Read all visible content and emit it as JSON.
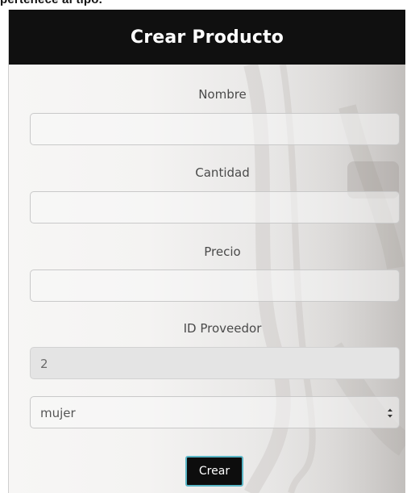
{
  "top_strip_text": "pertenece al tipo.",
  "form": {
    "title": "Crear Producto",
    "fields": [
      {
        "label": "Nombre",
        "value": ""
      },
      {
        "label": "Cantidad",
        "value": ""
      },
      {
        "label": "Precio",
        "value": ""
      },
      {
        "label": "ID Proveedor",
        "value": "2",
        "disabled": true
      }
    ],
    "select": {
      "selected": "mujer"
    },
    "submit_label": "Crear"
  },
  "colors": {
    "header_bg": "#101010",
    "button_bg": "#0d0d0d",
    "button_outline": "#5ab6c6"
  }
}
